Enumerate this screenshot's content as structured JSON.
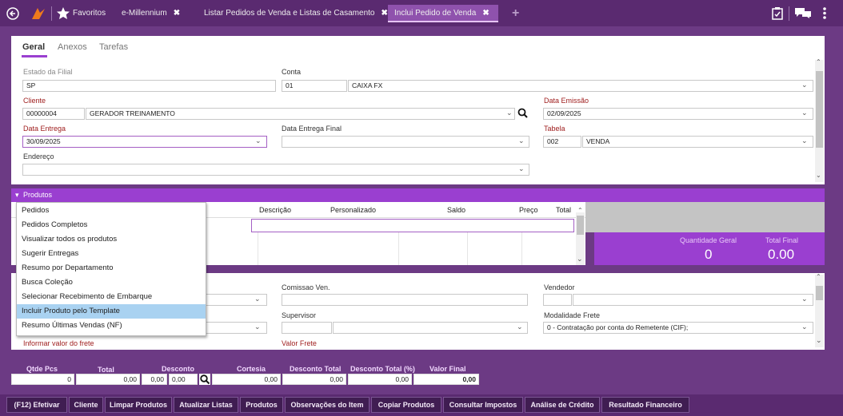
{
  "tabs": {
    "favorites": "Favoritos",
    "emillennium": "e-Millennium",
    "listar": "Listar Pedidos de Venda e Listas de Casamento",
    "inclui": "Inclui Pedido de Venda",
    "close": "✖"
  },
  "subtabs": [
    "Geral",
    "Anexos",
    "Tarefas"
  ],
  "form": {
    "estado_label": "Estado da Filial",
    "estado_value": "SP",
    "conta_label": "Conta",
    "conta_code": "01",
    "conta_name": "CAIXA FX",
    "cliente_label": "Cliente",
    "cliente_code": "00000004",
    "cliente_name": "GERADOR TREINAMENTO",
    "data_emissao_label": "Data Emissão",
    "data_emissao_value": "02/09/2025",
    "data_entrega_label": "Data Entrega",
    "data_entrega_value": "30/09/2025",
    "data_entrega_final_label": "Data Entrega Final",
    "tabela_label": "Tabela",
    "tabela_code": "002",
    "tabela_name": "VENDA",
    "endereco_label": "Endereço"
  },
  "produtos": {
    "title": "Produtos",
    "columns": [
      "Descrição",
      "Personalizado",
      "Saldo",
      "Preço",
      "Total"
    ],
    "qtd_geral_label": "Quantidade Geral",
    "qtd_geral_value": "0",
    "total_final_label": "Total Final",
    "total_final_value": "0.00"
  },
  "menu": [
    "Pedidos",
    "Pedidos Completos",
    "Visualizar todos os produtos",
    "Sugerir Entregas",
    "Resumo por Departamento",
    "Busca Coleção",
    "Selecionar Recebimento de Embarque",
    "Incluir Produto pelo Template",
    "Resumo Últimas Vendas (NF)"
  ],
  "lower": {
    "comissao_label": "Comissao Ven.",
    "vendedor_label": "Vendedor",
    "supervisor_label": "Supervisor",
    "modalidade_label": "Modalidade Frete",
    "modalidade_value": "0 - Contratação por conta do Remetente (CIF);",
    "frete_info_label": "Informar valor do frete",
    "valor_frete_label": "Valor Frete"
  },
  "totals": {
    "qtde_label": "Qtde Pcs",
    "qtde_value": "0",
    "total_label": "Total",
    "total_value": "0,00",
    "desconto_label": "Desconto",
    "desconto_v1": "0,00",
    "desconto_v2": "0,00",
    "cortesia_label": "Cortesia",
    "cortesia_value": "0,00",
    "desc_total_label": "Desconto Total",
    "desc_total_value": "0,00",
    "desc_total_pct_label": "Desconto Total (%)",
    "desc_total_pct_value": "0,00",
    "valor_final_label": "Valor Final",
    "valor_final_value": "0,00"
  },
  "buttons": [
    "(F12) Efetivar",
    "Cliente",
    "Limpar Produtos",
    "Atualizar Listas",
    "Produtos",
    "Observações do Item",
    "Copiar Produtos",
    "Consultar Impostos",
    "Análise de Crédito",
    "Resultado Financeiro"
  ],
  "colors": {
    "header": "#5a2a70",
    "accent": "#9a3fd0",
    "menu_selected": "#a9d2f1"
  }
}
